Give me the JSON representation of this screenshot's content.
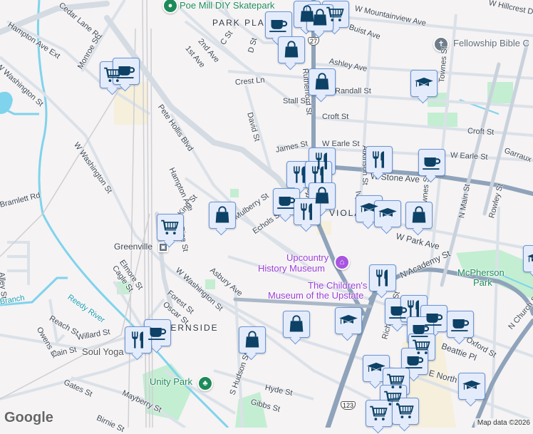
{
  "neighborhoods": {
    "park_place": "PARK PLACE",
    "viola": "VIOLA",
    "fernside": "FERNSIDE"
  },
  "pois": {
    "skatepark": "Poe Mill DIY Skatepark",
    "fellowship": "Fellowship Bible C",
    "upcountry_1": "Upcountry",
    "upcountry_2": "History Museum",
    "childrens_1": "The Children's",
    "childrens_2": "Museum of the Upstate",
    "mcpherson_1": "McPherson",
    "mcpherson_2": "Park",
    "unity_park": "Unity Park",
    "soul_yoga": "Soul Yoga",
    "greenville": "Greenville"
  },
  "streets": {
    "cedar_lane": "Cedar Lane Rd",
    "hampton_ext": "Hampton Ave Ext",
    "monroe": "Monroe St",
    "w_washington_1": "W Washington St",
    "w_washington_2": "W Washington St",
    "w_washington_3": "W Washington St",
    "bramlett": "Bramlett Rd",
    "pete_hollis": "Pete Hollis Blvd",
    "hampton": "Hampton Ave",
    "second_ave": "2nd Ave",
    "c_st": "C St",
    "first_ave": "1st Ave",
    "d_st": "D St",
    "crest": "Crest Ln",
    "david": "David St",
    "king": "King St",
    "mulberry": "Mulberry St",
    "echols": "Echols St",
    "pine": "Pine St",
    "rutherford_1": "Rutherford St",
    "rutherford_2": "Rutherford St",
    "mountainview": "W Mountainview Ave",
    "hillcrest": "W Hillcrest Dr",
    "buist": "Buist Ave",
    "ashley": "Ashley Ave",
    "randall": "Randall St",
    "stall": "Stall St",
    "croft_1": "Croft St",
    "croft_2": "Croft St",
    "james": "James St",
    "w_earle_1": "W Earle St",
    "w_earle_2": "W Earle St",
    "stone": "W Stone Ave",
    "townes_1": "Townes St",
    "townes_2": "Townes St",
    "n_main": "N Main St",
    "garraux": "Garraux St",
    "rowley": "Rowley St",
    "ivy": "Ivy St",
    "atkinson": "Atkinson St",
    "w_park": "W Park Ave",
    "n_academy": "N Academy St",
    "n_church": "N Church St",
    "beattie": "Beattie Pl",
    "e_north": "E North St",
    "richardson": "Richardson St",
    "hyde": "Hyde St",
    "gibbs": "Gibbs St",
    "s_hudson": "S Hudson St",
    "asbury": "Asbury Ave",
    "forest": "Forest St",
    "oscar": "Oscar St",
    "elmore": "Elmore St",
    "cagle": "Cagle St",
    "alley": "Alley St",
    "reach": "Reach St",
    "owens": "Owens St",
    "willard": "Willard St",
    "cain": "Cain St",
    "gates": "Gates St",
    "mayberry": "Mayberry St",
    "birnie": "Birnie St",
    "reedy": "Reedy River",
    "branch": "Branch",
    "route_27": "27",
    "route_123": "123",
    "oxford": "Oxford St"
  },
  "footer": {
    "google": "Google",
    "attribution": "Map data ©2026"
  },
  "colors": {
    "marker_bg": "#e4ecfb",
    "marker_border": "#6a95d8",
    "icon": "#0d4166",
    "major_road": "#8fa3ba",
    "minor_road": "#dbe1e8",
    "water": "#7fd3ec",
    "park": "#bfeccf"
  }
}
